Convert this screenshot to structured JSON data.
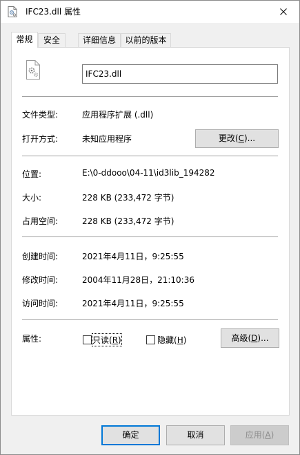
{
  "window": {
    "title": "IFC23.dll 属性",
    "close_label": "✕"
  },
  "tabs": [
    {
      "label": "常规",
      "active": true
    },
    {
      "label": "安全",
      "active": false
    },
    {
      "label": "详细信息",
      "active": false
    },
    {
      "label": "以前的版本",
      "active": false
    }
  ],
  "general": {
    "file_name": "IFC23.dll",
    "file_type_label": "文件类型:",
    "file_type_value": "应用程序扩展 (.dll)",
    "opens_with_label": "打开方式:",
    "opens_with_value": "未知应用程序",
    "change_button": {
      "text": "更改(",
      "key": "C",
      "suffix": ")..."
    },
    "location_label": "位置:",
    "location_value": "E:\\0-ddooo\\04-11\\id3lib_194282",
    "size_label": "大小:",
    "size_value": "228 KB (233,472 字节)",
    "size_on_disk_label": "占用空间:",
    "size_on_disk_value": "228 KB (233,472 字节)",
    "created_label": "创建时间:",
    "created_value": "2021年4月11日，9:25:55",
    "modified_label": "修改时间:",
    "modified_value": "2004年11月28日，21:10:36",
    "accessed_label": "访问时间:",
    "accessed_value": "2021年4月11日，9:25:55",
    "attributes_label": "属性:",
    "readonly": {
      "text": "只读(",
      "key": "R",
      "suffix": ")",
      "checked": false
    },
    "hidden": {
      "text": "隐藏(",
      "key": "H",
      "suffix": ")",
      "checked": false
    },
    "advanced_button": {
      "text": "高级(",
      "key": "D",
      "suffix": ")..."
    }
  },
  "footer": {
    "ok_label": "确定",
    "cancel_label": "取消",
    "apply": {
      "text": "应用(",
      "key": "A",
      "suffix": ")"
    }
  },
  "icons": {
    "title": "dll-file-icon",
    "file": "dll-gear-file-icon",
    "close": "close-icon"
  },
  "colors": {
    "accent": "#0078d7",
    "button_bg": "#e1e1e1",
    "separator": "#a0a0a0"
  }
}
